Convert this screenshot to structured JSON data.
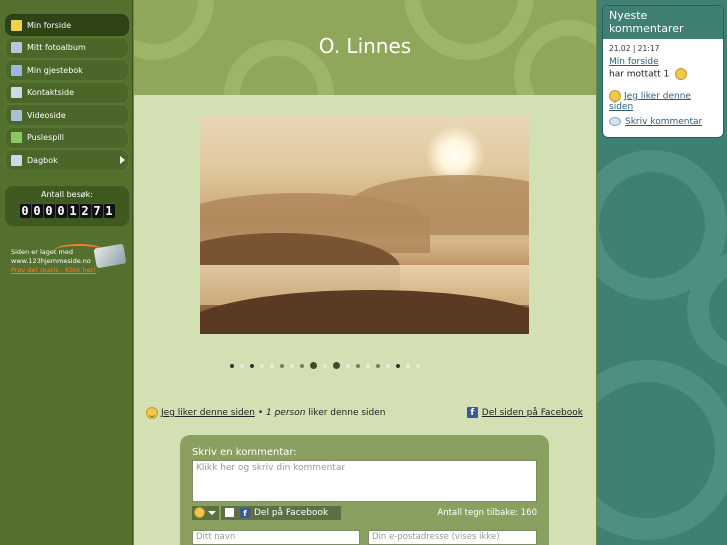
{
  "sidebar": {
    "items": [
      {
        "label": "Min forside",
        "icon": "home-icon",
        "color": "#f0d34a"
      },
      {
        "label": "Mitt fotoalbum",
        "icon": "photo-album-icon",
        "color": "#b8c6e0"
      },
      {
        "label": "Min gjestebok",
        "icon": "guestbook-icon",
        "color": "#9bb7df"
      },
      {
        "label": "Kontaktside",
        "icon": "contact-icon",
        "color": "#cdd9ea"
      },
      {
        "label": "Videoside",
        "icon": "video-icon",
        "color": "#a8c0d8"
      },
      {
        "label": "Puslespill",
        "icon": "puzzle-icon",
        "color": "#8cc862"
      },
      {
        "label": "Dagbok",
        "icon": "diary-icon",
        "color": "#cdd9ea"
      }
    ],
    "counter": {
      "label": "Antall besøk:",
      "digits": [
        "0",
        "0",
        "0",
        "0",
        "1",
        "2",
        "7",
        "1"
      ]
    },
    "made_with": {
      "line1": "Siden er laget med",
      "line2": "www.123hjemmeside.no",
      "link": "Prøv det gratis - Klikk her!"
    }
  },
  "header": {
    "title": "O. Linnes"
  },
  "slideshow": {
    "dot_count": 19
  },
  "like_bar": {
    "like_link": "Jeg liker denne siden",
    "separator": " • ",
    "count_text": "1 person",
    "suffix": " liker denne siden",
    "fb_share": "Del siden på Facebook"
  },
  "comment_form": {
    "title": "Skriv en kommentar:",
    "textarea_placeholder": "Klikk her og skriv din kommentar",
    "fb_button": "Del på Facebook",
    "chars_left": "Antall tegn tilbake: 160",
    "name_placeholder": "Ditt navn",
    "email_placeholder": "Din e-postadresse (vises ikke)"
  },
  "latest_comments": {
    "title": "Nyeste kommentarer",
    "timestamp": "21.02 | 21:17",
    "page_link": "Min forside",
    "received": "har mottatt 1",
    "like_link": "Jeg liker denne siden",
    "write_link": "Skriv kommentar"
  },
  "colors": {
    "sidebar_bg": "#53702f",
    "content_bg": "#d3e0b3",
    "right_bg": "#3f7f74",
    "accent_orange": "#ff7a2a"
  }
}
